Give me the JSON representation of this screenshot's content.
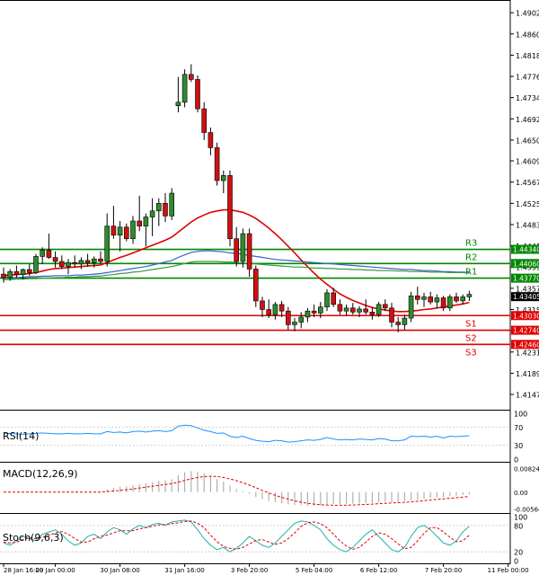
{
  "chart_data": {
    "type": "candlestick",
    "price_axis": {
      "ylim": [
        1.4124,
        1.492
      ],
      "ticks": [
        "1.49020",
        "1.48600",
        "1.48180",
        "1.47760",
        "1.47340",
        "1.46920",
        "1.46500",
        "1.46090",
        "1.45670",
        "1.45250",
        "1.44830",
        "1.44410",
        "1.43990",
        "1.43570",
        "1.43150",
        "1.42730",
        "1.42310",
        "1.41890",
        "1.41470"
      ]
    },
    "x_axis": {
      "labels": [
        {
          "text": "28 Jan 16:00",
          "x": 0
        },
        {
          "text": "29 Jan 00:00",
          "x": 8
        },
        {
          "text": "30 Jan 08:00",
          "x": 18
        },
        {
          "text": "31 Jan 16:00",
          "x": 28
        },
        {
          "text": "3 Feb 20:00",
          "x": 38
        },
        {
          "text": "5 Feb 04:00",
          "x": 48
        },
        {
          "text": "6 Feb 12:00",
          "x": 58
        },
        {
          "text": "7 Feb 20:00",
          "x": 68
        },
        {
          "text": "11 Feb 00:00",
          "x": 78
        }
      ]
    },
    "candles": [
      {
        "o": 1.4385,
        "h": 1.4398,
        "l": 1.4368,
        "c": 1.4378
      },
      {
        "o": 1.4378,
        "h": 1.4395,
        "l": 1.4372,
        "c": 1.439
      },
      {
        "o": 1.439,
        "h": 1.4402,
        "l": 1.4378,
        "c": 1.4384
      },
      {
        "o": 1.4384,
        "h": 1.4396,
        "l": 1.4375,
        "c": 1.4394
      },
      {
        "o": 1.4394,
        "h": 1.4405,
        "l": 1.4382,
        "c": 1.4388
      },
      {
        "o": 1.4388,
        "h": 1.4425,
        "l": 1.4385,
        "c": 1.442
      },
      {
        "o": 1.442,
        "h": 1.4438,
        "l": 1.4405,
        "c": 1.4432
      },
      {
        "o": 1.4432,
        "h": 1.4465,
        "l": 1.4415,
        "c": 1.4418
      },
      {
        "o": 1.4418,
        "h": 1.443,
        "l": 1.4398,
        "c": 1.441
      },
      {
        "o": 1.441,
        "h": 1.4422,
        "l": 1.4395,
        "c": 1.44
      },
      {
        "o": 1.44,
        "h": 1.4415,
        "l": 1.4385,
        "c": 1.4408
      },
      {
        "o": 1.4408,
        "h": 1.4422,
        "l": 1.4398,
        "c": 1.4405
      },
      {
        "o": 1.4405,
        "h": 1.4418,
        "l": 1.4395,
        "c": 1.4412
      },
      {
        "o": 1.4412,
        "h": 1.4425,
        "l": 1.44,
        "c": 1.4408
      },
      {
        "o": 1.4408,
        "h": 1.442,
        "l": 1.4398,
        "c": 1.4415
      },
      {
        "o": 1.4415,
        "h": 1.443,
        "l": 1.4405,
        "c": 1.441
      },
      {
        "o": 1.441,
        "h": 1.4505,
        "l": 1.44,
        "c": 1.448
      },
      {
        "o": 1.448,
        "h": 1.452,
        "l": 1.4455,
        "c": 1.4462
      },
      {
        "o": 1.4462,
        "h": 1.449,
        "l": 1.443,
        "c": 1.4478
      },
      {
        "o": 1.4478,
        "h": 1.4485,
        "l": 1.445,
        "c": 1.4455
      },
      {
        "o": 1.4455,
        "h": 1.45,
        "l": 1.4445,
        "c": 1.449
      },
      {
        "o": 1.449,
        "h": 1.454,
        "l": 1.447,
        "c": 1.448
      },
      {
        "o": 1.448,
        "h": 1.4505,
        "l": 1.444,
        "c": 1.4498
      },
      {
        "o": 1.4498,
        "h": 1.4535,
        "l": 1.446,
        "c": 1.451
      },
      {
        "o": 1.451,
        "h": 1.4535,
        "l": 1.448,
        "c": 1.4525
      },
      {
        "o": 1.4525,
        "h": 1.4545,
        "l": 1.4488,
        "c": 1.45
      },
      {
        "o": 1.45,
        "h": 1.4555,
        "l": 1.4492,
        "c": 1.4545
      },
      {
        "o": 1.4718,
        "h": 1.4775,
        "l": 1.4705,
        "c": 1.4725
      },
      {
        "o": 1.4725,
        "h": 1.479,
        "l": 1.4715,
        "c": 1.478
      },
      {
        "o": 1.478,
        "h": 1.48,
        "l": 1.4765,
        "c": 1.477
      },
      {
        "o": 1.477,
        "h": 1.4778,
        "l": 1.4705,
        "c": 1.4712
      },
      {
        "o": 1.4712,
        "h": 1.4725,
        "l": 1.465,
        "c": 1.4665
      },
      {
        "o": 1.4665,
        "h": 1.4675,
        "l": 1.462,
        "c": 1.4635
      },
      {
        "o": 1.4635,
        "h": 1.4645,
        "l": 1.456,
        "c": 1.457
      },
      {
        "o": 1.457,
        "h": 1.459,
        "l": 1.4545,
        "c": 1.458
      },
      {
        "o": 1.458,
        "h": 1.459,
        "l": 1.444,
        "c": 1.4455
      },
      {
        "o": 1.4455,
        "h": 1.4478,
        "l": 1.44,
        "c": 1.441
      },
      {
        "o": 1.441,
        "h": 1.4475,
        "l": 1.4398,
        "c": 1.4465
      },
      {
        "o": 1.4465,
        "h": 1.4475,
        "l": 1.438,
        "c": 1.4395
      },
      {
        "o": 1.4395,
        "h": 1.4402,
        "l": 1.432,
        "c": 1.4332
      },
      {
        "o": 1.4332,
        "h": 1.434,
        "l": 1.43,
        "c": 1.4315
      },
      {
        "o": 1.4315,
        "h": 1.4335,
        "l": 1.4298,
        "c": 1.4305
      },
      {
        "o": 1.4305,
        "h": 1.433,
        "l": 1.4295,
        "c": 1.4325
      },
      {
        "o": 1.4325,
        "h": 1.4332,
        "l": 1.43,
        "c": 1.4312
      },
      {
        "o": 1.4312,
        "h": 1.432,
        "l": 1.4275,
        "c": 1.4285
      },
      {
        "o": 1.4285,
        "h": 1.4298,
        "l": 1.4272,
        "c": 1.429
      },
      {
        "o": 1.429,
        "h": 1.431,
        "l": 1.4278,
        "c": 1.43
      },
      {
        "o": 1.43,
        "h": 1.4318,
        "l": 1.429,
        "c": 1.4312
      },
      {
        "o": 1.4312,
        "h": 1.4325,
        "l": 1.43,
        "c": 1.4308
      },
      {
        "o": 1.4308,
        "h": 1.433,
        "l": 1.4298,
        "c": 1.432
      },
      {
        "o": 1.432,
        "h": 1.4355,
        "l": 1.4312,
        "c": 1.4348
      },
      {
        "o": 1.4348,
        "h": 1.4358,
        "l": 1.432,
        "c": 1.4325
      },
      {
        "o": 1.4325,
        "h": 1.4335,
        "l": 1.4305,
        "c": 1.4312
      },
      {
        "o": 1.4312,
        "h": 1.4325,
        "l": 1.4302,
        "c": 1.4318
      },
      {
        "o": 1.4318,
        "h": 1.4328,
        "l": 1.4305,
        "c": 1.431
      },
      {
        "o": 1.431,
        "h": 1.4322,
        "l": 1.43,
        "c": 1.4316
      },
      {
        "o": 1.4316,
        "h": 1.4335,
        "l": 1.4305,
        "c": 1.431
      },
      {
        "o": 1.431,
        "h": 1.432,
        "l": 1.4295,
        "c": 1.4305
      },
      {
        "o": 1.4305,
        "h": 1.433,
        "l": 1.43,
        "c": 1.4325
      },
      {
        "o": 1.4325,
        "h": 1.4335,
        "l": 1.4312,
        "c": 1.4318
      },
      {
        "o": 1.4318,
        "h": 1.4328,
        "l": 1.428,
        "c": 1.429
      },
      {
        "o": 1.429,
        "h": 1.43,
        "l": 1.427,
        "c": 1.4285
      },
      {
        "o": 1.4285,
        "h": 1.4305,
        "l": 1.4275,
        "c": 1.4298
      },
      {
        "o": 1.4298,
        "h": 1.435,
        "l": 1.429,
        "c": 1.4342
      },
      {
        "o": 1.4342,
        "h": 1.436,
        "l": 1.4325,
        "c": 1.4335
      },
      {
        "o": 1.4335,
        "h": 1.4348,
        "l": 1.432,
        "c": 1.434
      },
      {
        "o": 1.434,
        "h": 1.435,
        "l": 1.4325,
        "c": 1.433
      },
      {
        "o": 1.433,
        "h": 1.4345,
        "l": 1.4318,
        "c": 1.4338
      },
      {
        "o": 1.4338,
        "h": 1.4342,
        "l": 1.4312,
        "c": 1.4318
      },
      {
        "o": 1.4318,
        "h": 1.4345,
        "l": 1.4312,
        "c": 1.434
      },
      {
        "o": 1.434,
        "h": 1.4348,
        "l": 1.4328,
        "c": 1.4332
      },
      {
        "o": 1.4332,
        "h": 1.4345,
        "l": 1.4325,
        "c": 1.434
      },
      {
        "o": 1.434,
        "h": 1.4352,
        "l": 1.4332,
        "c": 1.4345
      }
    ],
    "moving_averages": [
      {
        "color": "#e00000",
        "values": [
          1.4382,
          1.4383,
          1.4384,
          1.4385,
          1.4386,
          1.4388,
          1.4391,
          1.4394,
          1.4396,
          1.4397,
          1.4398,
          1.4399,
          1.44,
          1.4401,
          1.4402,
          1.4403,
          1.4408,
          1.4413,
          1.4418,
          1.4422,
          1.4427,
          1.4432,
          1.4437,
          1.4442,
          1.4447,
          1.4452,
          1.4458,
          1.4468,
          1.4478,
          1.4488,
          1.4496,
          1.4502,
          1.4507,
          1.451,
          1.4512,
          1.4512,
          1.451,
          1.4507,
          1.4502,
          1.4495,
          1.4486,
          1.4476,
          1.4465,
          1.4453,
          1.444,
          1.4427,
          1.4413,
          1.44,
          1.4387,
          1.4375,
          1.4365,
          1.4355,
          1.4346,
          1.4339,
          1.4333,
          1.4328,
          1.4323,
          1.4319,
          1.4316,
          1.4314,
          1.4312,
          1.4311,
          1.4311,
          1.4312,
          1.4313,
          1.4315,
          1.4316,
          1.4318,
          1.432,
          1.4322,
          1.4324,
          1.4326,
          1.4329
        ]
      },
      {
        "color": "#3a5fcd",
        "values": [
          1.4378,
          1.4378,
          1.4378,
          1.4379,
          1.438,
          1.438,
          1.4381,
          1.4381,
          1.4382,
          1.4382,
          1.4382,
          1.4383,
          1.4383,
          1.4384,
          1.4385,
          1.4386,
          1.4388,
          1.439,
          1.4392,
          1.4394,
          1.4396,
          1.4398,
          1.44,
          1.4403,
          1.4406,
          1.4409,
          1.4412,
          1.4418,
          1.4423,
          1.4428,
          1.443,
          1.4431,
          1.4431,
          1.443,
          1.4429,
          1.4427,
          1.4426,
          1.4424,
          1.4422,
          1.442,
          1.4418,
          1.4416,
          1.4414,
          1.4413,
          1.4412,
          1.4411,
          1.441,
          1.4409,
          1.4408,
          1.4407,
          1.4406,
          1.4405,
          1.4404,
          1.4403,
          1.4402,
          1.4401,
          1.44,
          1.4399,
          1.4398,
          1.4397,
          1.4396,
          1.4395,
          1.4394,
          1.4394,
          1.4393,
          1.4392,
          1.4392,
          1.4391,
          1.439,
          1.439,
          1.4389,
          1.4389,
          1.4388
        ]
      },
      {
        "color": "#3a9a3a",
        "values": [
          1.4374,
          1.4374,
          1.4375,
          1.4375,
          1.4376,
          1.4376,
          1.4377,
          1.4377,
          1.4378,
          1.4378,
          1.4379,
          1.4379,
          1.438,
          1.438,
          1.4381,
          1.4381,
          1.4383,
          1.4384,
          1.4386,
          1.4387,
          1.4389,
          1.439,
          1.4392,
          1.4394,
          1.4396,
          1.4398,
          1.44,
          1.4403,
          1.4406,
          1.4409,
          1.441,
          1.441,
          1.441,
          1.441,
          1.4409,
          1.4409,
          1.4408,
          1.4407,
          1.4406,
          1.4405,
          1.4404,
          1.4403,
          1.4402,
          1.4401,
          1.44,
          1.4399,
          1.4399,
          1.4398,
          1.4397,
          1.4397,
          1.4396,
          1.4396,
          1.4395,
          1.4395,
          1.4394,
          1.4394,
          1.4393,
          1.4393,
          1.4392,
          1.4392,
          1.4392,
          1.4391,
          1.4391,
          1.439,
          1.439,
          1.439,
          1.4389,
          1.4389,
          1.4389,
          1.4388,
          1.4388,
          1.4388,
          1.4387
        ]
      }
    ],
    "levels": [
      {
        "name": "R3",
        "value": 1.4434,
        "label": "1.44340",
        "color": "#008800"
      },
      {
        "name": "R2",
        "value": 1.4406,
        "label": "1.44060",
        "color": "#008800"
      },
      {
        "name": "R1",
        "value": 1.4377,
        "label": "1.43770",
        "color": "#008800"
      },
      {
        "name": "S1",
        "value": 1.4303,
        "label": "1.43030",
        "color": "#e00000"
      },
      {
        "name": "S2",
        "value": 1.4274,
        "label": "1.42740",
        "color": "#e00000"
      },
      {
        "name": "S3",
        "value": 1.4246,
        "label": "1.42460",
        "color": "#e00000"
      }
    ],
    "last_price": {
      "value": 1.43405,
      "label": "1.43405"
    },
    "indicators": {
      "rsi": {
        "title": "RSI(14)",
        "ylim": [
          0,
          100
        ],
        "ticks": [
          "100",
          "70",
          "30",
          "0"
        ],
        "values": [
          55,
          56,
          55,
          54,
          55,
          56,
          57,
          56,
          55,
          55,
          56,
          55,
          55,
          56,
          55,
          55,
          60,
          58,
          59,
          57,
          60,
          61,
          59,
          61,
          62,
          60,
          62,
          72,
          74,
          73,
          68,
          63,
          60,
          56,
          57,
          50,
          47,
          50,
          45,
          41,
          39,
          38,
          41,
          40,
          37,
          38,
          40,
          42,
          41,
          43,
          47,
          44,
          42,
          43,
          42,
          44,
          43,
          42,
          45,
          44,
          40,
          40,
          42,
          50,
          49,
          50,
          48,
          50,
          46,
          50,
          49,
          50,
          51
        ]
      },
      "macd": {
        "title": "MACD(12,26,9)",
        "ylim": [
          -0.0062,
          0.0088
        ],
        "ticks": [
          "0.008248",
          "0.00",
          "-0.005648"
        ],
        "histogram": [
          0,
          0,
          0,
          0,
          0,
          0,
          0,
          0,
          0,
          0,
          0,
          0,
          0,
          0,
          0,
          0,
          0.001,
          0.0015,
          0.0018,
          0.002,
          0.0024,
          0.0028,
          0.003,
          0.0034,
          0.0038,
          0.004,
          0.0044,
          0.0058,
          0.0068,
          0.0072,
          0.007,
          0.0064,
          0.0056,
          0.0044,
          0.0036,
          0.0022,
          0.001,
          0.0004,
          -0.0006,
          -0.0016,
          -0.0024,
          -0.003,
          -0.0034,
          -0.0038,
          -0.0042,
          -0.0044,
          -0.0045,
          -0.0046,
          -0.0046,
          -0.0045,
          -0.0042,
          -0.0041,
          -0.0041,
          -0.004,
          -0.004,
          -0.0039,
          -0.0038,
          -0.0037,
          -0.0034,
          -0.0033,
          -0.0034,
          -0.0034,
          -0.0033,
          -0.0028,
          -0.0025,
          -0.0022,
          -0.002,
          -0.0018,
          -0.0017,
          -0.0014,
          -0.0012,
          -0.001,
          -0.0008
        ],
        "signal": [
          0,
          0,
          0,
          0,
          0,
          0,
          0,
          0,
          0,
          0,
          0,
          0,
          0,
          0,
          0,
          0,
          0.0002,
          0.0004,
          0.0006,
          0.0008,
          0.0011,
          0.0014,
          0.0017,
          0.002,
          0.0023,
          0.0026,
          0.0029,
          0.0034,
          0.004,
          0.0045,
          0.005,
          0.0053,
          0.0054,
          0.0053,
          0.005,
          0.0045,
          0.0039,
          0.0032,
          0.0024,
          0.0015,
          0.0006,
          -0.0003,
          -0.0011,
          -0.0018,
          -0.0024,
          -0.003,
          -0.0034,
          -0.0038,
          -0.0041,
          -0.0043,
          -0.0044,
          -0.0045,
          -0.0045,
          -0.0045,
          -0.0044,
          -0.0043,
          -0.0042,
          -0.0041,
          -0.0039,
          -0.0038,
          -0.0037,
          -0.0036,
          -0.0035,
          -0.0033,
          -0.0031,
          -0.0029,
          -0.0027,
          -0.0025,
          -0.0023,
          -0.0021,
          -0.0019,
          -0.0017,
          -0.0015
        ]
      },
      "stoch": {
        "title": "Stoch(9,6,3)",
        "ylim": [
          0,
          100
        ],
        "ticks": [
          "100",
          "80",
          "20",
          "0"
        ],
        "main": [
          40,
          35,
          45,
          55,
          50,
          45,
          60,
          65,
          70,
          60,
          45,
          35,
          40,
          55,
          60,
          50,
          65,
          75,
          70,
          60,
          72,
          80,
          75,
          82,
          85,
          80,
          88,
          90,
          92,
          88,
          70,
          50,
          35,
          25,
          30,
          20,
          28,
          40,
          55,
          45,
          35,
          30,
          40,
          55,
          70,
          85,
          90,
          88,
          80,
          70,
          50,
          35,
          25,
          20,
          30,
          45,
          60,
          70,
          55,
          40,
          25,
          20,
          30,
          55,
          75,
          80,
          70,
          55,
          40,
          35,
          45,
          65,
          78
        ],
        "signal": [
          42,
          40,
          42,
          48,
          52,
          50,
          53,
          57,
          63,
          66,
          60,
          50,
          42,
          42,
          50,
          55,
          58,
          63,
          68,
          68,
          68,
          72,
          75,
          78,
          81,
          82,
          84,
          86,
          89,
          90,
          85,
          75,
          58,
          43,
          32,
          28,
          26,
          30,
          38,
          46,
          48,
          42,
          37,
          40,
          50,
          63,
          78,
          86,
          88,
          84,
          75,
          60,
          45,
          33,
          26,
          30,
          42,
          55,
          63,
          60,
          50,
          38,
          27,
          30,
          45,
          62,
          75,
          75,
          65,
          53,
          43,
          45,
          58
        ]
      }
    }
  }
}
